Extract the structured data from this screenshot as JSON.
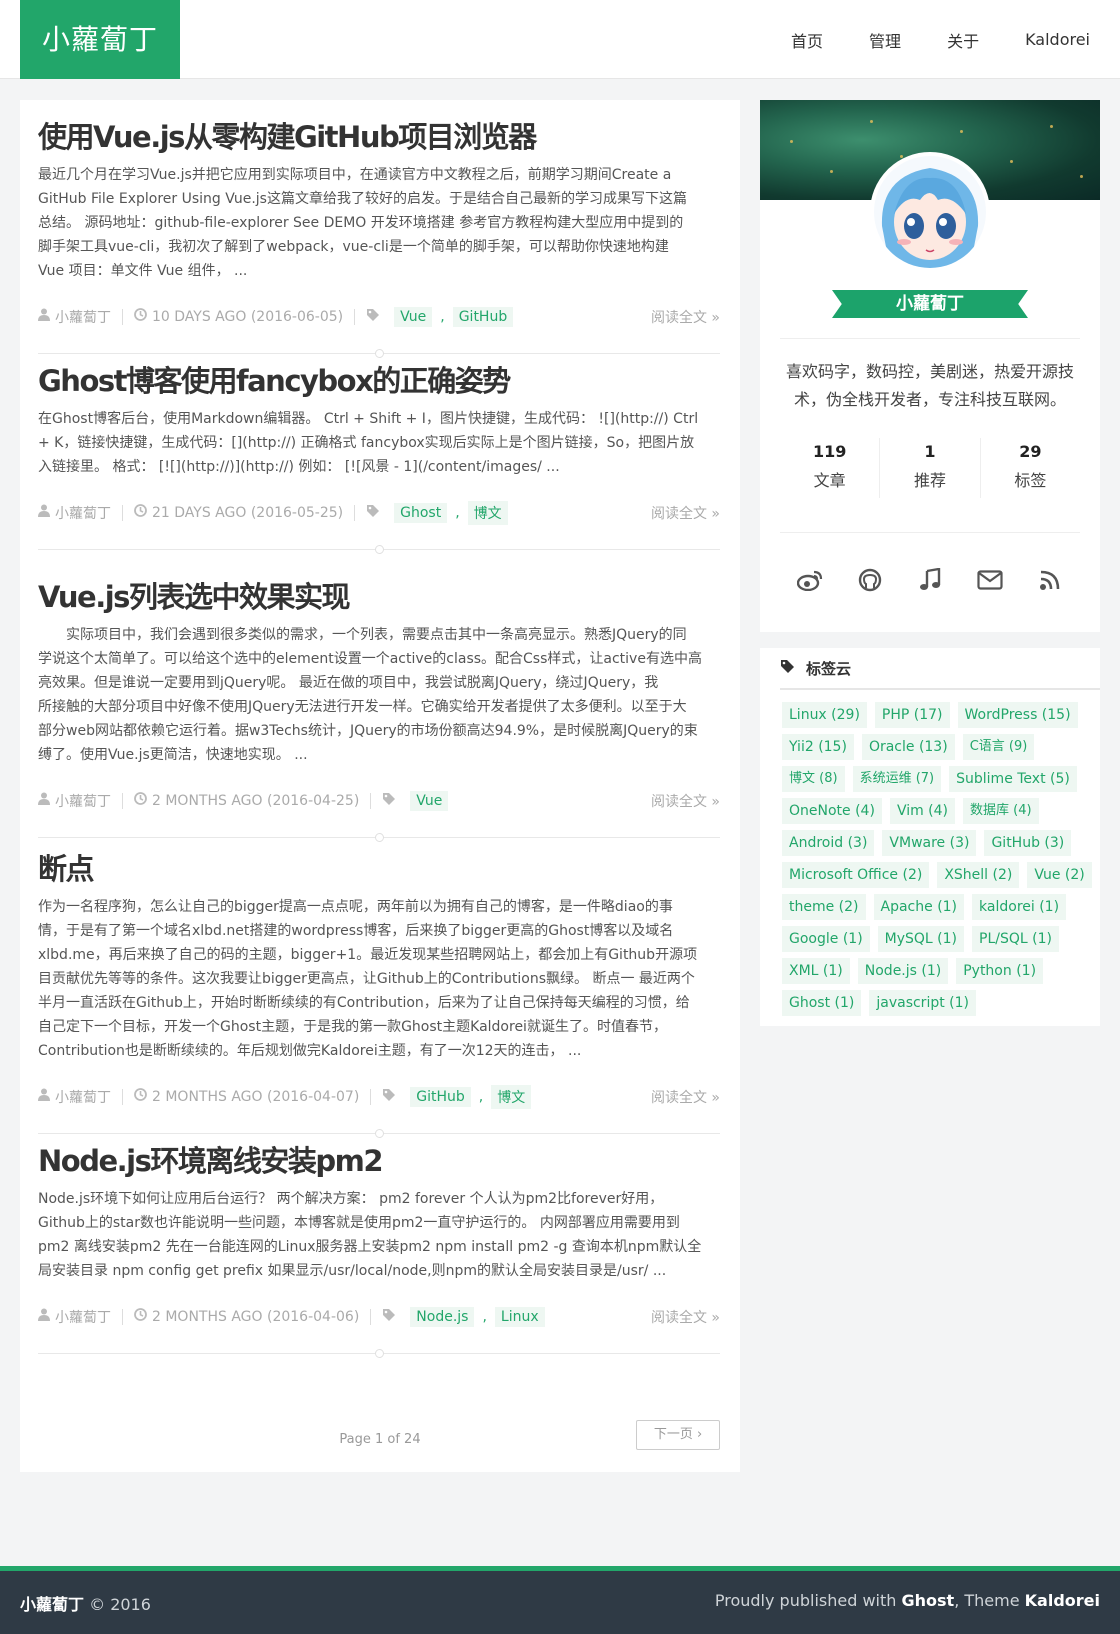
{
  "site": {
    "logo": "小蘿蔔丁",
    "accent": "#22a66a"
  },
  "nav": [
    "首页",
    "管理",
    "关于",
    "Kaldorei"
  ],
  "posts": [
    {
      "title": "使用Vue.js从零构建GitHub项目浏览器",
      "lines": [
        "最近几个月在学习Vue.js并把它应用到实际项目中，在通读官方中文教程之后，前期学习期间Create a",
        "GitHub File Explorer Using Vue.js这篇文章给我了较好的启发。于是结合自己最新的学习成果写下这篇",
        "总结。 源码地址：github-file-explorer See DEMO 开发环境搭建 参考官方教程构建大型应用中提到的",
        "脚手架工具vue-cli，我初次了解到了webpack，vue-cli是一个简单的脚手架，可以帮助你快速地构建",
        "Vue 项目：单文件 Vue 组件， ..."
      ],
      "author": "小蘿蔔丁",
      "date": "10 DAYS AGO (2016-06-05)",
      "tags": [
        "Vue",
        "GitHub"
      ],
      "read_more": "阅读全文 »"
    },
    {
      "title": "Ghost博客使用fancybox的正确姿势",
      "lines": [
        "在Ghost博客后台，使用Markdown编辑器。 Ctrl + Shift + I，图片快捷键，生成代码： ![](http://) Ctrl",
        "+ K，链接快捷键，生成代码：[](http://) 正确格式 fancybox实现后实际上是个图片链接，So，把图片放",
        "入链接里。 格式： [![](http://)](http://) 例如： [![风景 - 1](/content/images/ ..."
      ],
      "author": "小蘿蔔丁",
      "date": "21 DAYS AGO (2016-05-25)",
      "tags": [
        "Ghost",
        "博文"
      ],
      "read_more": "阅读全文 »"
    },
    {
      "title": "Vue.js列表选中效果实现",
      "lines": [
        "实际项目中，我们会遇到很多类似的需求，一个列表，需要点击其中一条高亮显示。熟悉JQuery的同",
        "学说这个太简单了。可以给这个选中的element设置一个active的class。配合Css样式，让active有选中高",
        "亮效果。但是谁说一定要用到jQuery呢。 最近在做的项目中，我尝试脱离JQuery，绕过JQuery，我",
        "所接触的大部分项目中好像不使用JQuery无法进行开发一样。它确实给开发者提供了太多便利。以至于大",
        "部分web网站都依赖它运行着。据w3Techs统计，JQuery的市场份额高达94.9%，是时候脱离JQuery的束",
        "缚了。使用Vue.js更简洁，快速地实现。 ..."
      ],
      "author": "小蘿蔔丁",
      "date": "2 MONTHS AGO (2016-04-25)",
      "tags": [
        "Vue"
      ],
      "read_more": "阅读全文 »"
    },
    {
      "title": "断点",
      "lines": [
        "作为一名程序狗，怎么让自己的bigger提高一点点呢，两年前以为拥有自己的博客，是一件略diao的事",
        "情，于是有了第一个域名xlbd.net搭建的wordpress博客，后来换了bigger更高的Ghost博客以及域名",
        "xlbd.me，再后来换了自己的码的主题，bigger+1。最近发现某些招聘网站上，都会加上有Github开源项",
        "目贡献优先等等的条件。这次我要让bigger更高点，让Github上的Contributions飘绿。 断点一 最近两个",
        "半月一直活跃在Github上，开始时断断续续的有Contribution，后来为了让自己保持每天编程的习惯，给",
        "自己定下一个目标，开发一个Ghost主题，于是我的第一款Ghost主题Kaldorei就诞生了。时值春节，",
        "Contribution也是断断续续的。年后规划做完Kaldorei主题，有了一次12天的连击， ..."
      ],
      "author": "小蘿蔔丁",
      "date": "2 MONTHS AGO (2016-04-07)",
      "tags": [
        "GitHub",
        "博文"
      ],
      "read_more": "阅读全文 »"
    },
    {
      "title": "Node.js环境离线安装pm2",
      "lines": [
        "Node.js环境下如何让应用后台运行？ 两个解决方案： pm2 forever 个人认为pm2比forever好用，",
        "Github上的star数也许能说明一些问题，本博客就是使用pm2一直守护运行的。 内网部署应用需要用到",
        "pm2 离线安装pm2 先在一台能连网的Linux服务器上安装pm2 npm install pm2 -g 查询本机npm默认全",
        "局安装目录 npm config get prefix 如果显示/usr/local/node,则npm的默认全局安装目录是/usr/ ..."
      ],
      "author": "小蘿蔔丁",
      "date": "2 MONTHS AGO (2016-04-06)",
      "tags": [
        "Node.js",
        "Linux"
      ],
      "read_more": "阅读全文 »"
    }
  ],
  "pagination": {
    "info": "Page 1 of 24",
    "next": "下一页 ›"
  },
  "profile": {
    "name": "小蘿蔔丁",
    "bio": "喜欢码字，数码控，美剧迷，热爱开源技术，伪全栈开发者，专注科技互联网。",
    "stats": [
      {
        "num": "119",
        "label": "文章"
      },
      {
        "num": "1",
        "label": "推荐"
      },
      {
        "num": "29",
        "label": "标签"
      }
    ],
    "social_icons": [
      "weibo-icon",
      "github-icon",
      "music-icon",
      "mail-icon",
      "rss-icon"
    ]
  },
  "tagcloud": {
    "title": "标签云",
    "tags": [
      "Linux (29)",
      "PHP (17)",
      "WordPress (15)",
      "Yii2 (15)",
      "Oracle (13)",
      "C语言 (9)",
      "博文 (8)",
      "系统运维 (7)",
      "Sublime Text (5)",
      "OneNote (4)",
      "Vim (4)",
      "数据库 (4)",
      "Android (3)",
      "VMware (3)",
      "GitHub (3)",
      "Microsoft Office (2)",
      "XShell (2)",
      "Vue (2)",
      "theme (2)",
      "Apache (1)",
      "kaldorei (1)",
      "Google (1)",
      "MySQL (1)",
      "PL/SQL (1)",
      "XML (1)",
      "Node.js (1)",
      "Python (1)",
      "Ghost (1)",
      "javascript (1)"
    ]
  },
  "footer": {
    "brand": "小蘿蔔丁",
    "year": "© 2016",
    "published": "Proudly published with",
    "ghost": "Ghost",
    "theme_label": ", Theme",
    "theme": "Kaldorei"
  }
}
